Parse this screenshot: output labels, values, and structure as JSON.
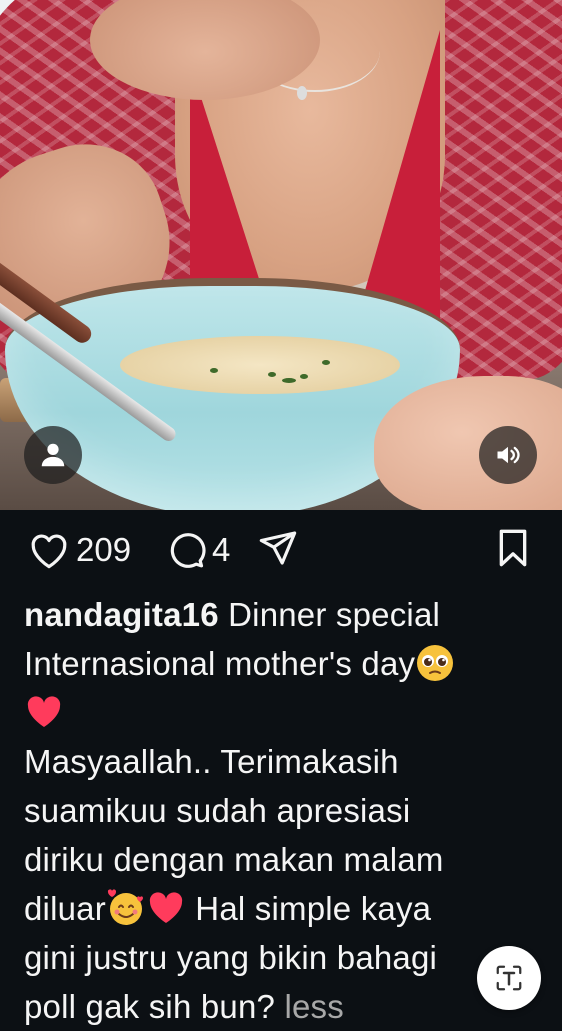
{
  "media": {
    "image_description_icon": "person-icon",
    "sound_icon": "volume-icon"
  },
  "actions": {
    "likes": "209",
    "comments": "4",
    "like_icon": "heart-outline-icon",
    "comment_icon": "comment-bubble-icon",
    "share_icon": "paper-plane-icon",
    "save_icon": "bookmark-icon"
  },
  "caption": {
    "username": "nandagita16",
    "line1": "Dinner special",
    "line2": "Internasional mother's day",
    "body1": "Masyaallah.. Terimakasih",
    "body2": "suamikuu sudah apresiasi",
    "body3": "diriku dengan makan malam",
    "body4a": "diluar",
    "body4b": "Hal simple kaya",
    "body5": "gini justru yang bikin bahagi",
    "body6": "poll gak sih bun?",
    "more": "less"
  },
  "floating": {
    "scan_icon": "text-scan-icon"
  },
  "colors": {
    "background": "#0c1014",
    "text": "#f5f5f5",
    "muted": "#a8a8a8",
    "heart": "#ff3b5c"
  }
}
